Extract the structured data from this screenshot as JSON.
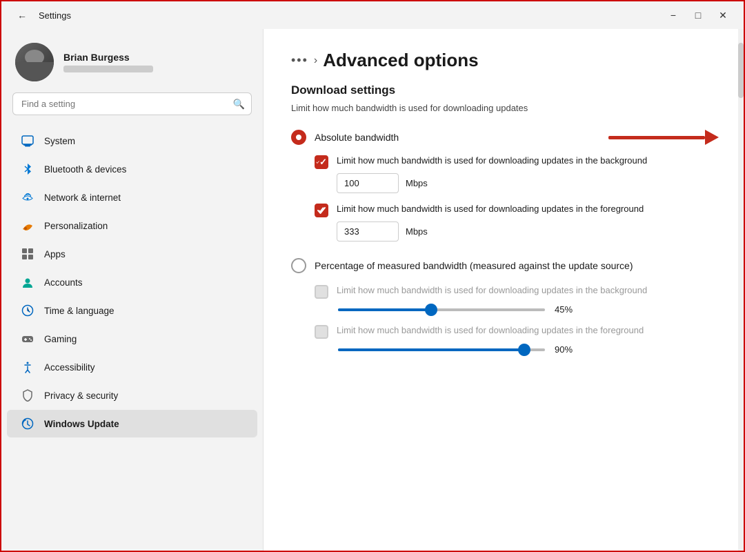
{
  "titleBar": {
    "title": "Settings",
    "backIcon": "←",
    "minimizeIcon": "−",
    "maximizeIcon": "□",
    "closeIcon": "✕"
  },
  "user": {
    "name": "Brian Burgess",
    "emailPlaceholder": "••••••••••••••"
  },
  "search": {
    "placeholder": "Find a setting"
  },
  "nav": {
    "items": [
      {
        "id": "system",
        "label": "System",
        "icon": "💻",
        "active": false
      },
      {
        "id": "bluetooth",
        "label": "Bluetooth & devices",
        "icon": "⬛",
        "active": false
      },
      {
        "id": "network",
        "label": "Network & internet",
        "icon": "📶",
        "active": false
      },
      {
        "id": "personalization",
        "label": "Personalization",
        "icon": "🖌",
        "active": false
      },
      {
        "id": "apps",
        "label": "Apps",
        "icon": "⊞",
        "active": false
      },
      {
        "id": "accounts",
        "label": "Accounts",
        "icon": "👤",
        "active": false
      },
      {
        "id": "time",
        "label": "Time & language",
        "icon": "🌐",
        "active": false
      },
      {
        "id": "gaming",
        "label": "Gaming",
        "icon": "🎮",
        "active": false
      },
      {
        "id": "accessibility",
        "label": "Accessibility",
        "icon": "♿",
        "active": false
      },
      {
        "id": "privacy",
        "label": "Privacy & security",
        "icon": "🛡",
        "active": false
      },
      {
        "id": "windows-update",
        "label": "Windows Update",
        "icon": "🔄",
        "active": true
      }
    ]
  },
  "main": {
    "breadcrumbDots": "•••",
    "breadcrumbSeparator": ">",
    "pageTitle": "Advanced options",
    "sectionTitle": "Download settings",
    "sectionDesc": "Limit how much bandwidth is used for downloading updates",
    "radioOptions": [
      {
        "id": "absolute",
        "label": "Absolute bandwidth",
        "selected": true
      },
      {
        "id": "percentage",
        "label": "Percentage of measured bandwidth (measured against the update source)",
        "selected": false
      }
    ],
    "absoluteOptions": [
      {
        "id": "background",
        "label": "Limit how much bandwidth is used for downloading updates in the background",
        "checked": true,
        "value": "100",
        "unit": "Mbps",
        "disabled": false
      },
      {
        "id": "foreground",
        "label": "Limit how much bandwidth is used for downloading updates in the foreground",
        "checked": true,
        "value": "333",
        "unit": "Mbps",
        "disabled": false
      }
    ],
    "percentageOptions": [
      {
        "id": "pct-background",
        "label": "Limit how much bandwidth is used for downloading updates in the background",
        "checked": false,
        "disabled": true,
        "sliderValue": 45,
        "sliderPercent": "45%"
      },
      {
        "id": "pct-foreground",
        "label": "Limit how much bandwidth is used for downloading updates in the foreground",
        "checked": false,
        "disabled": true,
        "sliderValue": 90,
        "sliderPercent": "90%"
      }
    ]
  }
}
